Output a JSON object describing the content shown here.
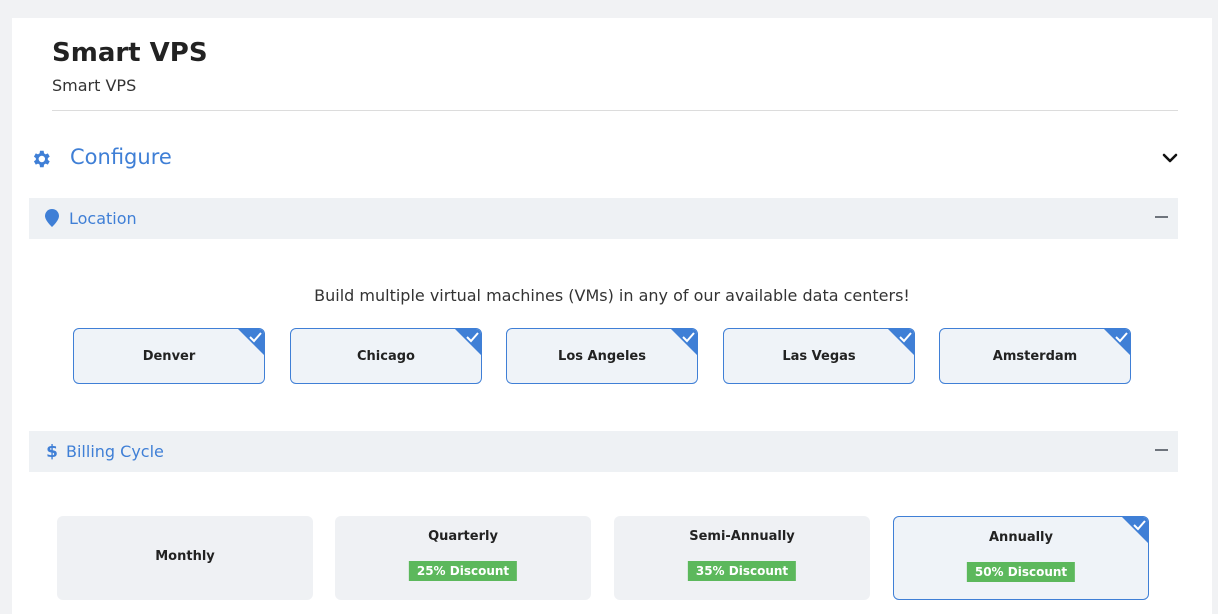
{
  "product": {
    "title": "Smart VPS",
    "subtitle": "Smart VPS"
  },
  "configure": {
    "title": "Configure",
    "icon": "gear-icon",
    "toggle_icon": "chevron-down-icon"
  },
  "location": {
    "label": "Location",
    "icon": "map-pin-icon",
    "description": "Build multiple virtual machines (VMs) in any of our available data centers!",
    "options": [
      {
        "label": "Denver",
        "selected": true
      },
      {
        "label": "Chicago",
        "selected": true
      },
      {
        "label": "Los Angeles",
        "selected": true
      },
      {
        "label": "Las Vegas",
        "selected": true
      },
      {
        "label": "Amsterdam",
        "selected": true
      }
    ]
  },
  "billing": {
    "label": "Billing Cycle",
    "icon": "dollar-icon",
    "options": [
      {
        "label": "Monthly",
        "discount": "",
        "selected": false
      },
      {
        "label": "Quarterly",
        "discount": "25% Discount",
        "selected": false
      },
      {
        "label": "Semi-Annually",
        "discount": "35% Discount",
        "selected": false
      },
      {
        "label": "Annually",
        "discount": "50% Discount",
        "selected": true
      }
    ]
  },
  "colors": {
    "accent": "#3f7fd6",
    "discount_badge": "#5cb85c",
    "section_bar": "#eef1f4"
  }
}
